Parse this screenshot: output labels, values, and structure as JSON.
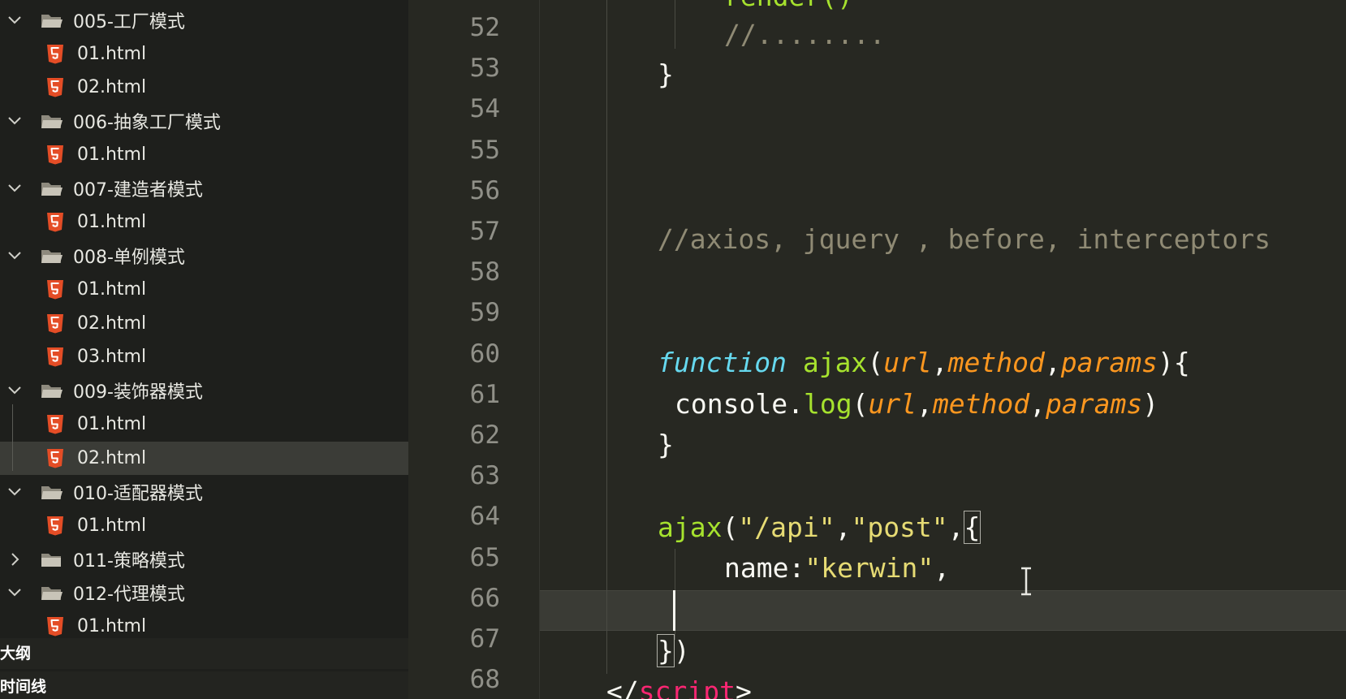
{
  "explorer": {
    "tree": [
      {
        "type": "folder",
        "expanded": true,
        "label": "005-工厂模式"
      },
      {
        "type": "file",
        "label": "01.html"
      },
      {
        "type": "file",
        "label": "02.html"
      },
      {
        "type": "folder",
        "expanded": true,
        "label": "006-抽象工厂模式"
      },
      {
        "type": "file",
        "label": "01.html"
      },
      {
        "type": "folder",
        "expanded": true,
        "label": "007-建造者模式"
      },
      {
        "type": "file",
        "label": "01.html"
      },
      {
        "type": "folder",
        "expanded": true,
        "label": "008-单例模式"
      },
      {
        "type": "file",
        "label": "01.html"
      },
      {
        "type": "file",
        "label": "02.html"
      },
      {
        "type": "file",
        "label": "03.html"
      },
      {
        "type": "folder",
        "expanded": true,
        "label": "009-装饰器模式"
      },
      {
        "type": "file",
        "label": "01.html"
      },
      {
        "type": "file",
        "label": "02.html",
        "selected": true
      },
      {
        "type": "folder",
        "expanded": true,
        "label": "010-适配器模式"
      },
      {
        "type": "file",
        "label": "01.html"
      },
      {
        "type": "folder",
        "expanded": false,
        "label": "011-策略模式"
      },
      {
        "type": "folder",
        "expanded": true,
        "label": "012-代理模式"
      },
      {
        "type": "file",
        "label": "01.html"
      }
    ],
    "outline_label": "大纲",
    "timeline_label": "时间线"
  },
  "editor": {
    "line_numbers": [
      "52",
      "53",
      "54",
      "55",
      "56",
      "57",
      "58",
      "59",
      "60",
      "61",
      "62",
      "63",
      "64",
      "65",
      "66",
      "67",
      "68"
    ],
    "top_partial_line": "render()",
    "code": {
      "l52": "//........",
      "l53": "}",
      "l57": "//axios, jquery , before, interceptors",
      "l60_kw": "function",
      "l60_name": "ajax",
      "l60_open": "(",
      "l60_p1": "url",
      "l60_c1": ",",
      "l60_p2": "method",
      "l60_c2": ",",
      "l60_p3": "params",
      "l60_close": "){",
      "l61_obj": "console.",
      "l61_fn": "log",
      "l61_open": "(",
      "l61_p1": "url",
      "l61_c1": ",",
      "l61_p2": "method",
      "l61_c2": ",",
      "l61_p3": "params",
      "l61_close": ")",
      "l62": "}",
      "l64_fn": "ajax",
      "l64_open": "(",
      "l64_s1": "\"/api\"",
      "l64_c1": ",",
      "l64_s2": "\"post\"",
      "l64_c2": ",",
      "l64_brace": "{",
      "l65_key": "name:",
      "l65_val": "\"kerwin\"",
      "l65_comma": ",",
      "l67_brace": "}",
      "l67_paren": ")",
      "l68_open": "</",
      "l68_tag": "script",
      "l68_close": ">"
    }
  },
  "colors": {
    "sidebar_bg": "#1e1f1c",
    "editor_bg": "#272822",
    "selected_row": "#3b3c37",
    "html5_icon": "#e44d26",
    "folder_icon": "#c8c4b8",
    "comment": "#8f8a74",
    "keyword": "#66d9ef",
    "function": "#a6e22e",
    "parameter": "#fd971f",
    "string": "#e6db74",
    "tag": "#f92672"
  },
  "icons": {
    "folder_open": "folder-open-icon",
    "folder_closed": "folder-icon",
    "file": "html5-file-icon",
    "expanded": "chevron-down-icon",
    "collapsed": "chevron-right-icon",
    "cursor": "text-cursor-icon"
  }
}
